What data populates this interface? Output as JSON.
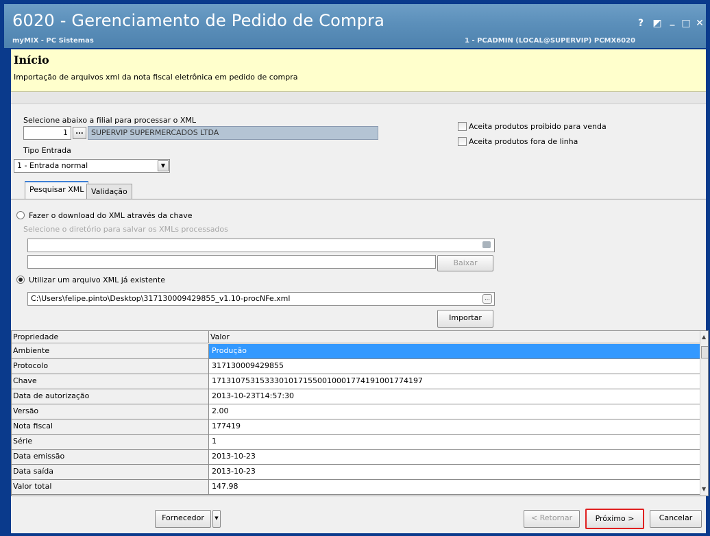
{
  "window": {
    "title": "6020 - Gerenciamento de Pedido de Compra",
    "subtitle": "myMIX - PC Sistemas",
    "user_info": "1 - PCADMIN (LOCAL@SUPERVIP)  PCMX6020",
    "controls": {
      "help": "?",
      "restore": "◩",
      "minimize": "_",
      "maximize": "□",
      "close": "✕"
    }
  },
  "header": {
    "title": "Início",
    "description": "Importação de arquivos xml da nota fiscal eletrônica em pedido de compra"
  },
  "form": {
    "filial_label": "Selecione abaixo a filial para processar o XML",
    "filial_code": "1",
    "filial_button": "...",
    "filial_name": "SUPERVIP SUPERMERCADOS LTDA",
    "tipo_entrada_label": "Tipo Entrada",
    "tipo_entrada_value": "1 - Entrada normal",
    "check_proibido": "Aceita produtos proibido para venda",
    "check_fora_linha": "Aceita produtos fora de linha"
  },
  "tabs": [
    {
      "label": "Pesquisar XML"
    },
    {
      "label": "Validação"
    }
  ],
  "pesquisar": {
    "radio_download": "Fazer o download do XML através da chave",
    "dir_hint": "Selecione o diretório para salvar os XMLs processados",
    "baixar_button": "Baixar",
    "radio_existente": "Utilizar um arquivo XML já existente",
    "file_path": "C:\\Users\\felipe.pinto\\Desktop\\317130009429855_v1.10-procNFe.xml",
    "importar_button": "Importar"
  },
  "grid": {
    "headers": [
      "Propriedade",
      "Valor"
    ],
    "rows": [
      {
        "prop": "Ambiente",
        "value": "Produção"
      },
      {
        "prop": "Protocolo",
        "value": "317130009429855"
      },
      {
        "prop": "Chave",
        "value": "17131075315333010171550010001774191001774197"
      },
      {
        "prop": "Data de autorização",
        "value": "2013-10-23T14:57:30"
      },
      {
        "prop": "Versão",
        "value": "2.00"
      },
      {
        "prop": "Nota fiscal",
        "value": "177419"
      },
      {
        "prop": "Série",
        "value": "1"
      },
      {
        "prop": "Data emissão",
        "value": "2013-10-23"
      },
      {
        "prop": "Data saída",
        "value": "2013-10-23"
      },
      {
        "prop": "Valor total",
        "value": "147.98"
      }
    ]
  },
  "footer": {
    "fornecedor_button": "Fornecedor",
    "retornar_button": "< Retornar",
    "proximo_button": "Próximo >",
    "cancelar_button": "Cancelar"
  },
  "colors": {
    "titlebar": "#5b8fba",
    "header_bg": "#ffffcc",
    "selected_row": "#3399ff",
    "highlight_border": "#e02020"
  }
}
